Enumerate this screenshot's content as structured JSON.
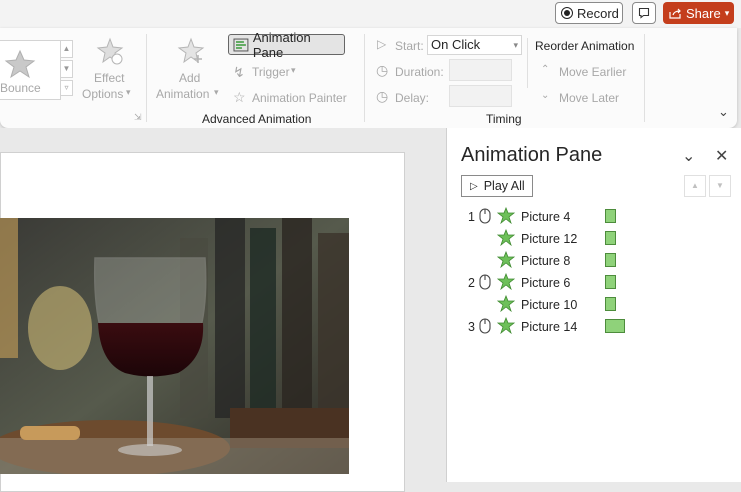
{
  "topbar": {
    "record_label": "Record",
    "share_label": "Share",
    "share_color": "#c43e1c"
  },
  "ribbon": {
    "effect_gallery": {
      "label": "Bounce"
    },
    "effect_options": {
      "line1": "Effect",
      "line2": "Options"
    },
    "add_animation": {
      "line1": "Add",
      "line2": "Animation"
    },
    "animation_pane_label": "Animation Pane",
    "trigger_label": "Trigger",
    "animation_painter_label": "Animation Painter",
    "advanced_group_label": "Advanced Animation",
    "start_label": "Start:",
    "start_value": "On Click",
    "duration_label": "Duration:",
    "delay_label": "Delay:",
    "timing_group_label": "Timing",
    "reorder_title": "Reorder Animation",
    "move_earlier_label": "Move Earlier",
    "move_later_label": "Move Later"
  },
  "pane": {
    "title": "Animation Pane",
    "play_all_label": "Play All",
    "items": [
      {
        "num": "1",
        "label": "Picture 4",
        "bar_fraction": 0.18
      },
      {
        "num": "",
        "label": "Picture 12",
        "bar_fraction": 0.18
      },
      {
        "num": "",
        "label": "Picture 8",
        "bar_fraction": 0.18
      },
      {
        "num": "2",
        "label": "Picture 6",
        "bar_fraction": 0.18
      },
      {
        "num": "",
        "label": "Picture 10",
        "bar_fraction": 0.18
      },
      {
        "num": "3",
        "label": "Picture 14",
        "bar_fraction": 0.36
      }
    ]
  },
  "colors": {
    "accent_green": "#8fd27a",
    "pane_bg": "#ffffff",
    "ribbon_bg": "#fbfbfb"
  }
}
